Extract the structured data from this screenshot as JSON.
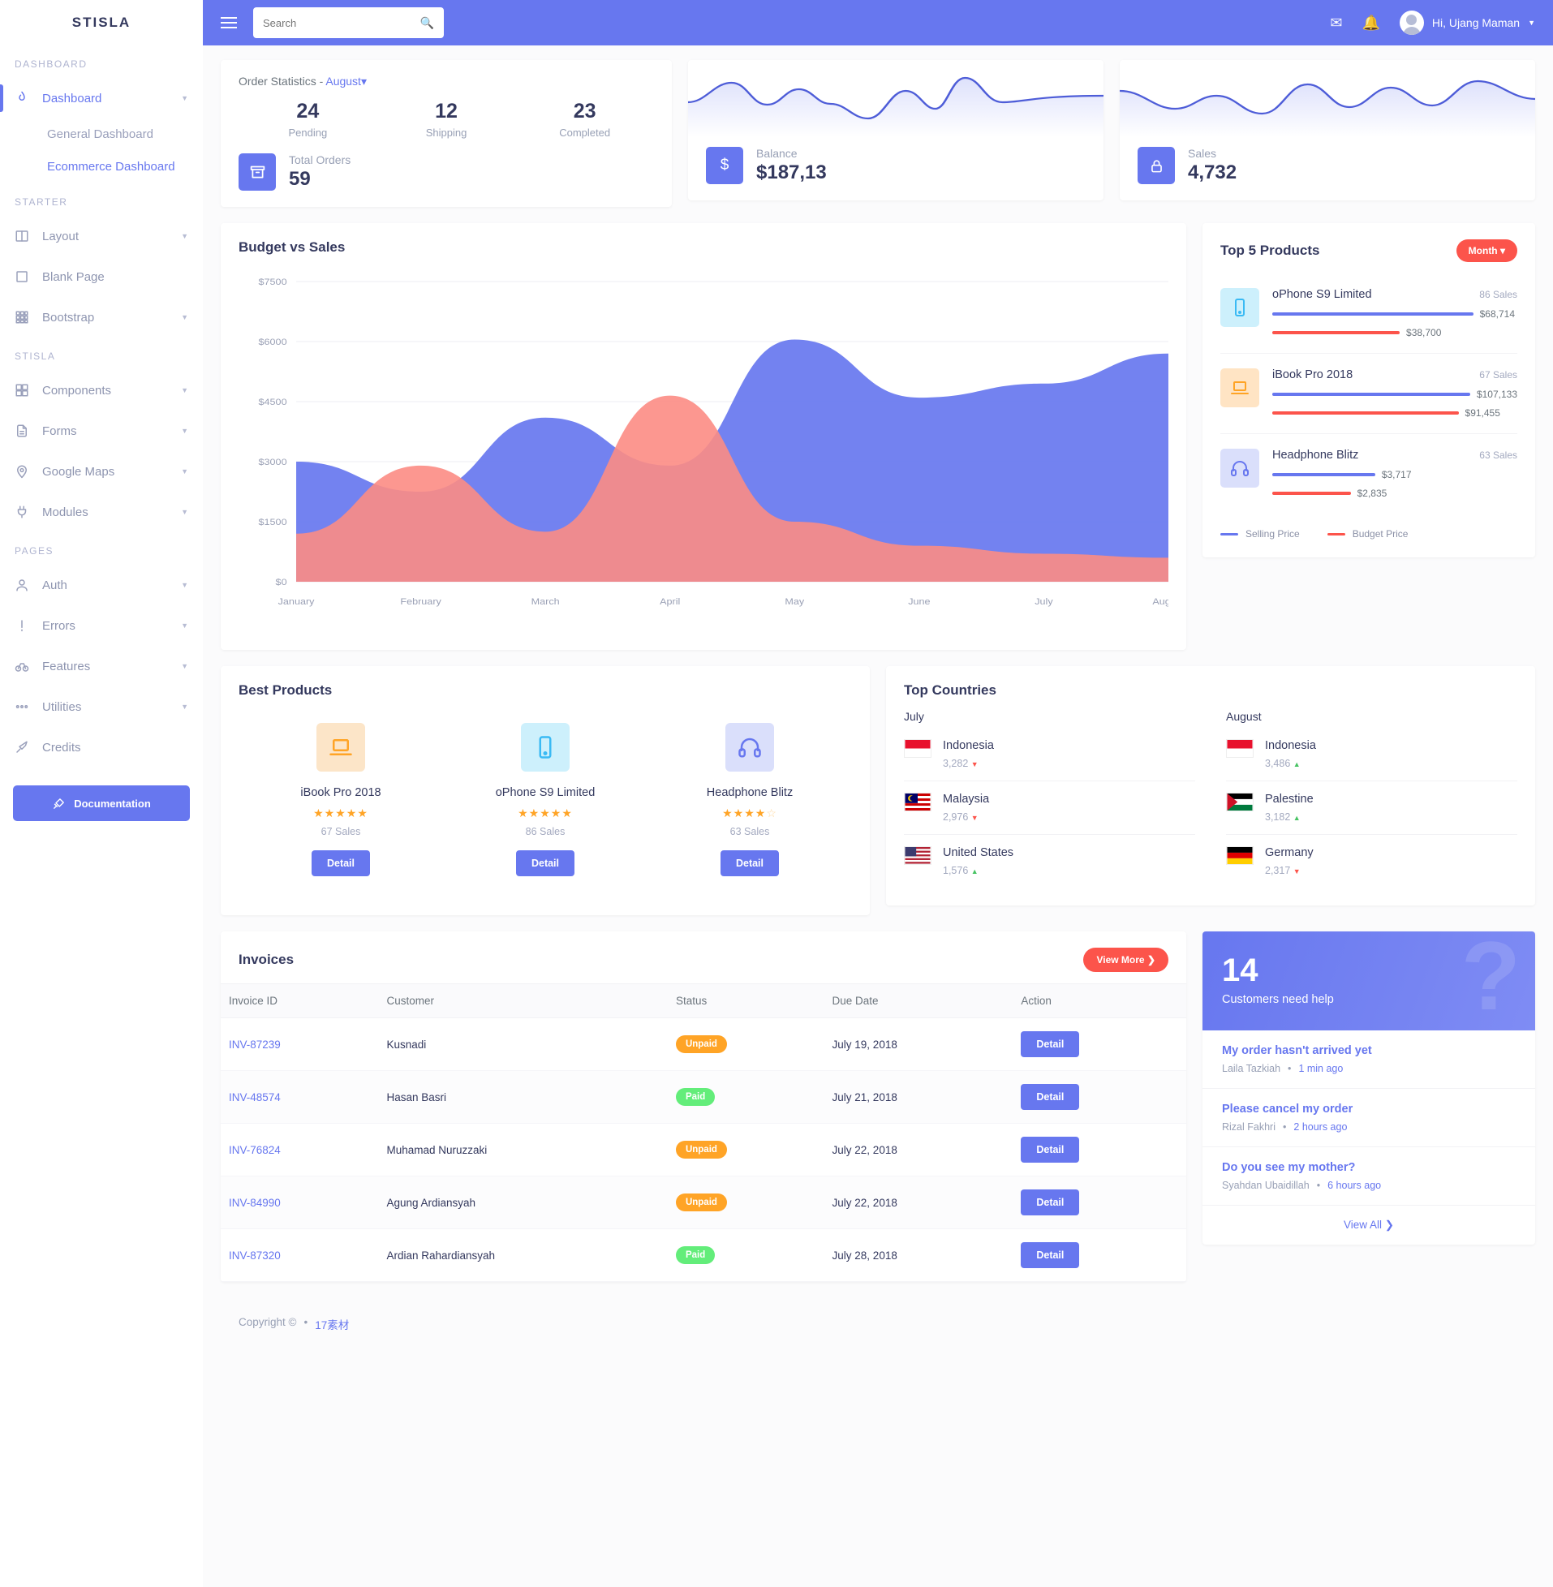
{
  "brand": "STISLA",
  "sidebar": {
    "sections": [
      {
        "title": "DASHBOARD",
        "items": [
          {
            "label": "Dashboard",
            "icon": "fire-icon",
            "caret": true,
            "active": true
          }
        ],
        "subs": [
          {
            "label": "General Dashboard",
            "active": false
          },
          {
            "label": "Ecommerce Dashboard",
            "active": true
          }
        ]
      },
      {
        "title": "STARTER",
        "items": [
          {
            "label": "Layout",
            "icon": "columns-icon",
            "caret": true,
            "active": false
          },
          {
            "label": "Blank Page",
            "icon": "square-icon",
            "caret": false,
            "active": false
          },
          {
            "label": "Bootstrap",
            "icon": "grid-icon",
            "caret": true,
            "active": false
          }
        ],
        "subs": []
      },
      {
        "title": "STISLA",
        "items": [
          {
            "label": "Components",
            "icon": "blocks-icon",
            "caret": true,
            "active": false
          },
          {
            "label": "Forms",
            "icon": "document-icon",
            "caret": true,
            "active": false
          },
          {
            "label": "Google Maps",
            "icon": "map-pin-icon",
            "caret": true,
            "active": false
          },
          {
            "label": "Modules",
            "icon": "plug-icon",
            "caret": true,
            "active": false
          }
        ],
        "subs": []
      },
      {
        "title": "PAGES",
        "items": [
          {
            "label": "Auth",
            "icon": "user-icon",
            "caret": true,
            "active": false
          },
          {
            "label": "Errors",
            "icon": "alert-icon",
            "caret": true,
            "active": false
          },
          {
            "label": "Features",
            "icon": "bicycle-icon",
            "caret": true,
            "active": false
          },
          {
            "label": "Utilities",
            "icon": "dots-icon",
            "caret": true,
            "active": false
          },
          {
            "label": "Credits",
            "icon": "tools-icon",
            "caret": false,
            "active": false
          }
        ],
        "subs": []
      }
    ],
    "documentation_button": "Documentation"
  },
  "topbar": {
    "search_placeholder": "Search",
    "search_value": "",
    "user_greeting": "Hi, Ujang Maman"
  },
  "order_statistics": {
    "title_prefix": "Order Statistics - ",
    "month": "August",
    "stats": [
      {
        "value": "24",
        "label": "Pending"
      },
      {
        "value": "12",
        "label": "Shipping"
      },
      {
        "value": "23",
        "label": "Completed"
      }
    ],
    "total_label": "Total Orders",
    "total_value": "59"
  },
  "balance_card": {
    "label": "Balance",
    "value": "$187,13"
  },
  "sales_card": {
    "label": "Sales",
    "value": "4,732"
  },
  "budget_chart": {
    "title": "Budget vs Sales"
  },
  "chart_data": {
    "type": "area",
    "title": "Budget vs Sales",
    "categories": [
      "January",
      "February",
      "March",
      "April",
      "May",
      "June",
      "July",
      "August"
    ],
    "ylim": [
      0,
      7500
    ],
    "ytick_labels": [
      "$0",
      "$1500",
      "$3000",
      "$4500",
      "$6000",
      "$7500"
    ],
    "ytick_values": [
      0,
      1500,
      3000,
      4500,
      6000,
      7500
    ],
    "grid": true,
    "legend": "none",
    "series": [
      {
        "name": "Sales",
        "color": "#6777ef",
        "values": [
          3000,
          2250,
          4100,
          2900,
          6050,
          4600,
          4950,
          5700
        ]
      },
      {
        "name": "Budget",
        "color": "#fc8c84",
        "values": [
          1200,
          2900,
          1250,
          4650,
          1500,
          900,
          700,
          600
        ]
      }
    ]
  },
  "top_products": {
    "title": "Top 5 Products",
    "period_button": "Month",
    "items": [
      {
        "name": "oPhone S9 Limited",
        "sales": "86 Sales",
        "icon": "phone-icon",
        "icon_bg": "#cdf0fc",
        "icon_color": "#3abaf4",
        "selling": {
          "value": "$68,714",
          "pct": 82
        },
        "budget": {
          "value": "$38,700",
          "pct": 52
        }
      },
      {
        "name": "iBook Pro 2018",
        "sales": "67 Sales",
        "icon": "laptop-icon",
        "icon_bg": "#ffe4c4",
        "icon_color": "#ffa426",
        "selling": {
          "value": "$107,133",
          "pct": 95
        },
        "budget": {
          "value": "$91,455",
          "pct": 76
        }
      },
      {
        "name": "Headphone Blitz",
        "sales": "63 Sales",
        "icon": "headphone-icon",
        "icon_bg": "#dadffb",
        "icon_color": "#6777ef",
        "selling": {
          "value": "$3,717",
          "pct": 42
        },
        "budget": {
          "value": "$2,835",
          "pct": 32
        }
      }
    ],
    "legend": [
      {
        "label": "Selling Price",
        "color": "#6777ef"
      },
      {
        "label": "Budget Price",
        "color": "#fc544b"
      }
    ]
  },
  "best_products": {
    "title": "Best Products",
    "items": [
      {
        "name": "iBook Pro 2018",
        "sales": "67 Sales",
        "stars": 5,
        "half": false,
        "icon": "laptop-icon",
        "icon_bg": "#fce5c8",
        "icon_color": "#ffa426",
        "button": "Detail"
      },
      {
        "name": "oPhone S9 Limited",
        "sales": "86 Sales",
        "stars": 4,
        "half": true,
        "icon": "phone-icon",
        "icon_bg": "#cdf0fc",
        "icon_color": "#3abaf4",
        "button": "Detail"
      },
      {
        "name": "Headphone Blitz",
        "sales": "63 Sales",
        "stars": 4,
        "half": false,
        "icon": "headphone-icon",
        "icon_bg": "#dadffb",
        "icon_color": "#6777ef",
        "button": "Detail"
      }
    ]
  },
  "top_countries": {
    "title": "Top Countries",
    "columns": [
      {
        "month": "July",
        "rows": [
          {
            "country": "Indonesia",
            "value": "3,282",
            "trend": "down",
            "flag": "id"
          },
          {
            "country": "Malaysia",
            "value": "2,976",
            "trend": "down",
            "flag": "my"
          },
          {
            "country": "United States",
            "value": "1,576",
            "trend": "up",
            "flag": "us"
          }
        ]
      },
      {
        "month": "August",
        "rows": [
          {
            "country": "Indonesia",
            "value": "3,486",
            "trend": "up",
            "flag": "id"
          },
          {
            "country": "Palestine",
            "value": "3,182",
            "trend": "up",
            "flag": "ps"
          },
          {
            "country": "Germany",
            "value": "2,317",
            "trend": "down",
            "flag": "de"
          }
        ]
      }
    ]
  },
  "invoices": {
    "title": "Invoices",
    "view_more": "View More",
    "columns": [
      "Invoice ID",
      "Customer",
      "Status",
      "Due Date",
      "Action"
    ],
    "rows": [
      {
        "id": "INV-87239",
        "customer": "Kusnadi",
        "status": "Unpaid",
        "due": "July 19, 2018",
        "action": "Detail"
      },
      {
        "id": "INV-48574",
        "customer": "Hasan Basri",
        "status": "Paid",
        "due": "July 21, 2018",
        "action": "Detail"
      },
      {
        "id": "INV-76824",
        "customer": "Muhamad Nuruzzaki",
        "status": "Unpaid",
        "due": "July 22, 2018",
        "action": "Detail"
      },
      {
        "id": "INV-84990",
        "customer": "Agung Ardiansyah",
        "status": "Unpaid",
        "due": "July 22, 2018",
        "action": "Detail"
      },
      {
        "id": "INV-87320",
        "customer": "Ardian Rahardiansyah",
        "status": "Paid",
        "due": "July 28, 2018",
        "action": "Detail"
      }
    ]
  },
  "help_panel": {
    "count": "14",
    "subtitle": "Customers need help",
    "items": [
      {
        "title": "My order hasn't arrived yet",
        "author": "Laila Tazkiah",
        "time": "1 min ago"
      },
      {
        "title": "Please cancel my order",
        "author": "Rizal Fakhri",
        "time": "2 hours ago"
      },
      {
        "title": "Do you see my mother?",
        "author": "Syahdan Ubaidillah",
        "time": "6 hours ago"
      }
    ],
    "view_all": "View All"
  },
  "footer": {
    "copyright": "Copyright ©",
    "link": "17素材"
  }
}
